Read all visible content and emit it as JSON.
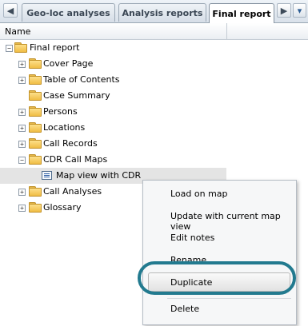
{
  "tabs": [
    {
      "label": "Geo-loc analyses"
    },
    {
      "label": "Analysis reports"
    },
    {
      "label": "Final report",
      "active": true
    }
  ],
  "nav": {
    "left": "◀",
    "right": "▶",
    "more": "▾"
  },
  "header": {
    "column_name": "Name"
  },
  "tree": {
    "root": "Final report",
    "items": [
      {
        "label": "Cover Page",
        "expandable": true
      },
      {
        "label": "Table of Contents",
        "expandable": true
      },
      {
        "label": "Case Summary",
        "expandable": false
      },
      {
        "label": "Persons",
        "expandable": true
      },
      {
        "label": "Locations",
        "expandable": true
      },
      {
        "label": "Call Records",
        "expandable": true
      },
      {
        "label": "CDR Call Maps",
        "expandable": true,
        "expanded": true
      },
      {
        "label": "Map view with CDR",
        "leaf": true,
        "selected": true
      },
      {
        "label": "Call Analyses",
        "expandable": true
      },
      {
        "label": "Glossary",
        "expandable": true
      }
    ]
  },
  "context_menu": {
    "items": [
      {
        "label": "Load on map"
      },
      {
        "label": "Update with current map view"
      },
      {
        "label": "Edit notes"
      },
      {
        "label": "Rename"
      },
      {
        "label": "Duplicate",
        "hovered": true
      },
      {
        "label": "Delete"
      }
    ]
  },
  "colors": {
    "highlight_ring": "#227a8f",
    "folder": "#f0bd45"
  }
}
